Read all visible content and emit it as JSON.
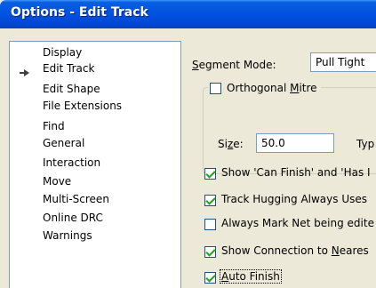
{
  "window": {
    "title": "Options - Edit Track"
  },
  "nav": {
    "items": [
      {
        "label": "Display"
      },
      {
        "label": "Edit Track",
        "selected": true
      },
      {
        "label": "Edit Shape"
      },
      {
        "label": "File Extensions"
      },
      {
        "label": "Find"
      },
      {
        "label": "General"
      },
      {
        "label": "Interaction"
      },
      {
        "label": "Move"
      },
      {
        "label": "Multi-Screen"
      },
      {
        "label": "Online DRC"
      },
      {
        "label": "Warnings"
      }
    ]
  },
  "segment_mode": {
    "label_prefix": "S",
    "label_rest": "egment Mode:",
    "value": "Pull Tight"
  },
  "orthogonal_mitre": {
    "label_prefix": "Orthogonal ",
    "label_u": "M",
    "label_rest": "itre",
    "checked": false
  },
  "size": {
    "label_pre": "Si",
    "label_u": "z",
    "label_post": "e:",
    "value": "50.0",
    "type_label": "Typ"
  },
  "options": [
    {
      "label": "Show 'Can Finish' and 'Has I",
      "checked": true
    },
    {
      "label": "Track Hugging Always Uses",
      "checked": true
    },
    {
      "label": "Always Mark Net being edite",
      "checked": false
    },
    {
      "label_pre": "Show Connection to ",
      "label_u": "N",
      "label_post": "eares",
      "checked": true
    },
    {
      "label_u": "A",
      "label_post": "uto Finish",
      "checked": true,
      "focused": true
    }
  ]
}
